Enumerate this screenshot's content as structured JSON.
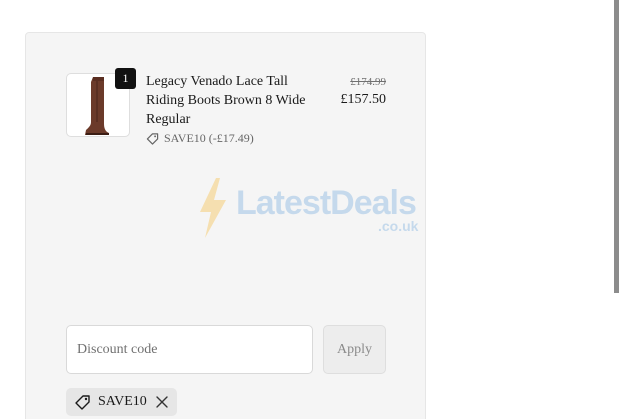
{
  "line_item": {
    "quantity": "1",
    "title": "Legacy Venado Lace Tall Riding Boots Brown 8 Wide Regular",
    "discount_text": "SAVE10 (-£17.49)",
    "price_original": "£174.99",
    "price_discounted": "£157.50",
    "thumbnail": "brown-riding-boot-image"
  },
  "watermark": {
    "brand": "LatestDeals",
    "domain": ".co.uk",
    "colors": {
      "bolt": "#f5b731",
      "text": "#6fa8dc"
    }
  },
  "discount_form": {
    "placeholder": "Discount code",
    "apply_label": "Apply"
  },
  "applied_code": {
    "label": "SAVE10"
  },
  "icons": {
    "tag": "tag-icon",
    "remove": "close-icon"
  }
}
